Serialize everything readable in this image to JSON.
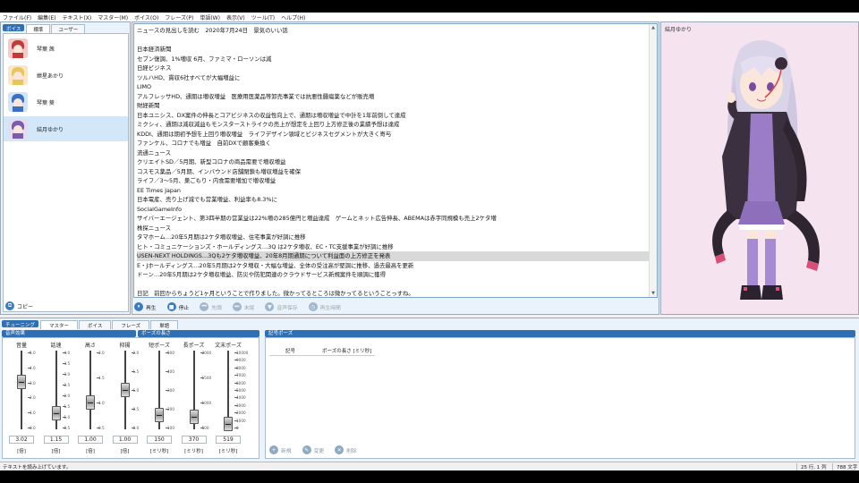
{
  "menu": [
    "ファイル(F)",
    "編集(E)",
    "テキスト(X)",
    "マスター(M)",
    "ボイス(O)",
    "フレーズ(P)",
    "単語(W)",
    "表示(V)",
    "ツール(T)",
    "ヘルプ(H)"
  ],
  "voice_panel": {
    "label": "ボイス",
    "tabs": [
      "標準",
      "ユーザー"
    ],
    "items": [
      "琴葉 茜",
      "紲星あかり",
      "琴葉 葵",
      "結月ゆかり"
    ],
    "selected_index": 3,
    "copy_label": "コピー"
  },
  "editor": {
    "lines": [
      "ニュースの見出しを読む　2020年7月24日　景気のいい話",
      "",
      "日本経済新聞",
      "セブン復調、1%増収 6月、ファミマ・ローソンは減",
      "日経ビジネス",
      "ツルハHD、貫収6社すべてが大幅増益に",
      "LIMO",
      "アルフレッサHD、通期は増収増益　医療用医薬品等卸売事業では抗悪性腫瘍薬などが販売増",
      "財経新聞",
      "日本ユニシス、DX案件の伸長とコアビジネスの収益性向上で、通期は増収増益で中計を1年前倒して達成",
      "ミクシィ、通期は減収減益もモンスターストライクの売上が想定を上回り上方修正後の業績予想は達成",
      "KDDI、通期は期初予想を上回り増収増益　ライフデザイン領域とビジネスセグメントが大きく寄与",
      "ファンケル、コロナでも増益　自前DXで顧客乗換く",
      "流通ニュース",
      "クリエイトSD／5月期、新型コロナの商品需要で増収増益",
      "コスモス薬品／5月期、インバウンド店舗閉鎖も増収増益を確保",
      "ライフ／3～5月、巣ごもり・内食需要増加で増収増益",
      "EE Times Japan",
      "日本電産、売り上げ減でも営業増益、利益率も8.3%に",
      "SocialGameInfo",
      "サイバーエージェント、第3四半期の営業益は22%増の285億円と増益達成　ゲームとネット広告伸長、ABEMAは赤字同規模も売上2ケタ増",
      "株探ニュース",
      "タマホーム…20年5月期は2ケタ増収増益、住宅事業が好調に推移",
      "ヒト・コミュニケーションズ・ホールディングス…3Q は2ケタ増収、EC・TC支援事業が好調に推移",
      "USEN-NEXT HOLDINGS…3Qも2ケタ増収増益、20年8月期通期について利益面の上方修正を発表",
      "E・Jホールディングス…20年5月期は2ケタ増収・大幅な増益、全体の受注高が堅調に推移、過去最高を更新",
      "ドーン…20年5月期は2ケタ増収増益、防災や防犯関連のクラウドサービス新規案件を順調に獲得",
      "",
      "日記　前回からちょうど1ヶ月ということで作りました。微かってるところは微かってるということっすね。"
    ],
    "highlight_index": 24
  },
  "playbar": [
    "再生",
    "停止",
    "先頭",
    "末尾",
    "音声保存",
    "再生時間"
  ],
  "character": {
    "name": "結月ゆかり"
  },
  "bottom_tabs": [
    "チューニング",
    "マスター",
    "ボイス",
    "フレーズ",
    "単語"
  ],
  "sliders_header": "音声効果",
  "pause_len_header": "ポーズの長さ",
  "sliders": [
    {
      "label": "音量",
      "ticks": [
        "5.0",
        "4.0",
        "3.0",
        "2.0",
        "1.0",
        "0.0"
      ],
      "min": 0,
      "max": 5,
      "value_num": 3.02,
      "value": "3.02",
      "unit": "[倍]"
    },
    {
      "label": "話速",
      "ticks": [
        "4.0",
        "3.5",
        "3.0",
        "2.5",
        "2.0",
        "1.5",
        "1.0",
        "0.5"
      ],
      "min": 0.5,
      "max": 4,
      "value_num": 1.15,
      "value": "1.15",
      "unit": "[倍]"
    },
    {
      "label": "高さ",
      "ticks": [
        "2.0",
        "1.5",
        "1.0",
        "0.5"
      ],
      "min": 0.5,
      "max": 2,
      "value_num": 1.0,
      "value": "1.00",
      "unit": "[倍]"
    },
    {
      "label": "抑揚",
      "ticks": [
        "2.0",
        "1.5",
        "1.0",
        "0.5",
        "0.0"
      ],
      "min": 0,
      "max": 2,
      "value_num": 1.0,
      "value": "1.00",
      "unit": "[倍]"
    },
    {
      "label": "短ポーズ",
      "ticks": [
        "500",
        "400",
        "300",
        "200",
        "100"
      ],
      "min": 80,
      "max": 500,
      "value_num": 150,
      "value": "150",
      "unit": "[ミリ秒]"
    },
    {
      "label": "長ポーズ",
      "ticks": [
        "2000",
        "1500",
        "1000",
        "500"
      ],
      "min": 100,
      "max": 2000,
      "value_num": 370,
      "value": "370",
      "unit": "[ミリ秒]"
    },
    {
      "label": "文末ポーズ",
      "ticks": [
        "10000",
        "9000",
        "8000",
        "7000",
        "6000",
        "5000",
        "4000",
        "3000",
        "2000",
        "1000",
        "0"
      ],
      "min": 0,
      "max": 10000,
      "value_num": 519,
      "value": "519",
      "unit": "[ミリ秒]"
    }
  ],
  "pause_panel": {
    "header": "記号ポーズ",
    "col1": "記号",
    "col2": "ポーズの長さ [ミリ秒]",
    "buttons": [
      "新規",
      "変更",
      "削除"
    ]
  },
  "status": {
    "message": "テキストを読み上げています。",
    "position": "25 行, 1 列",
    "count": "788 文字"
  }
}
